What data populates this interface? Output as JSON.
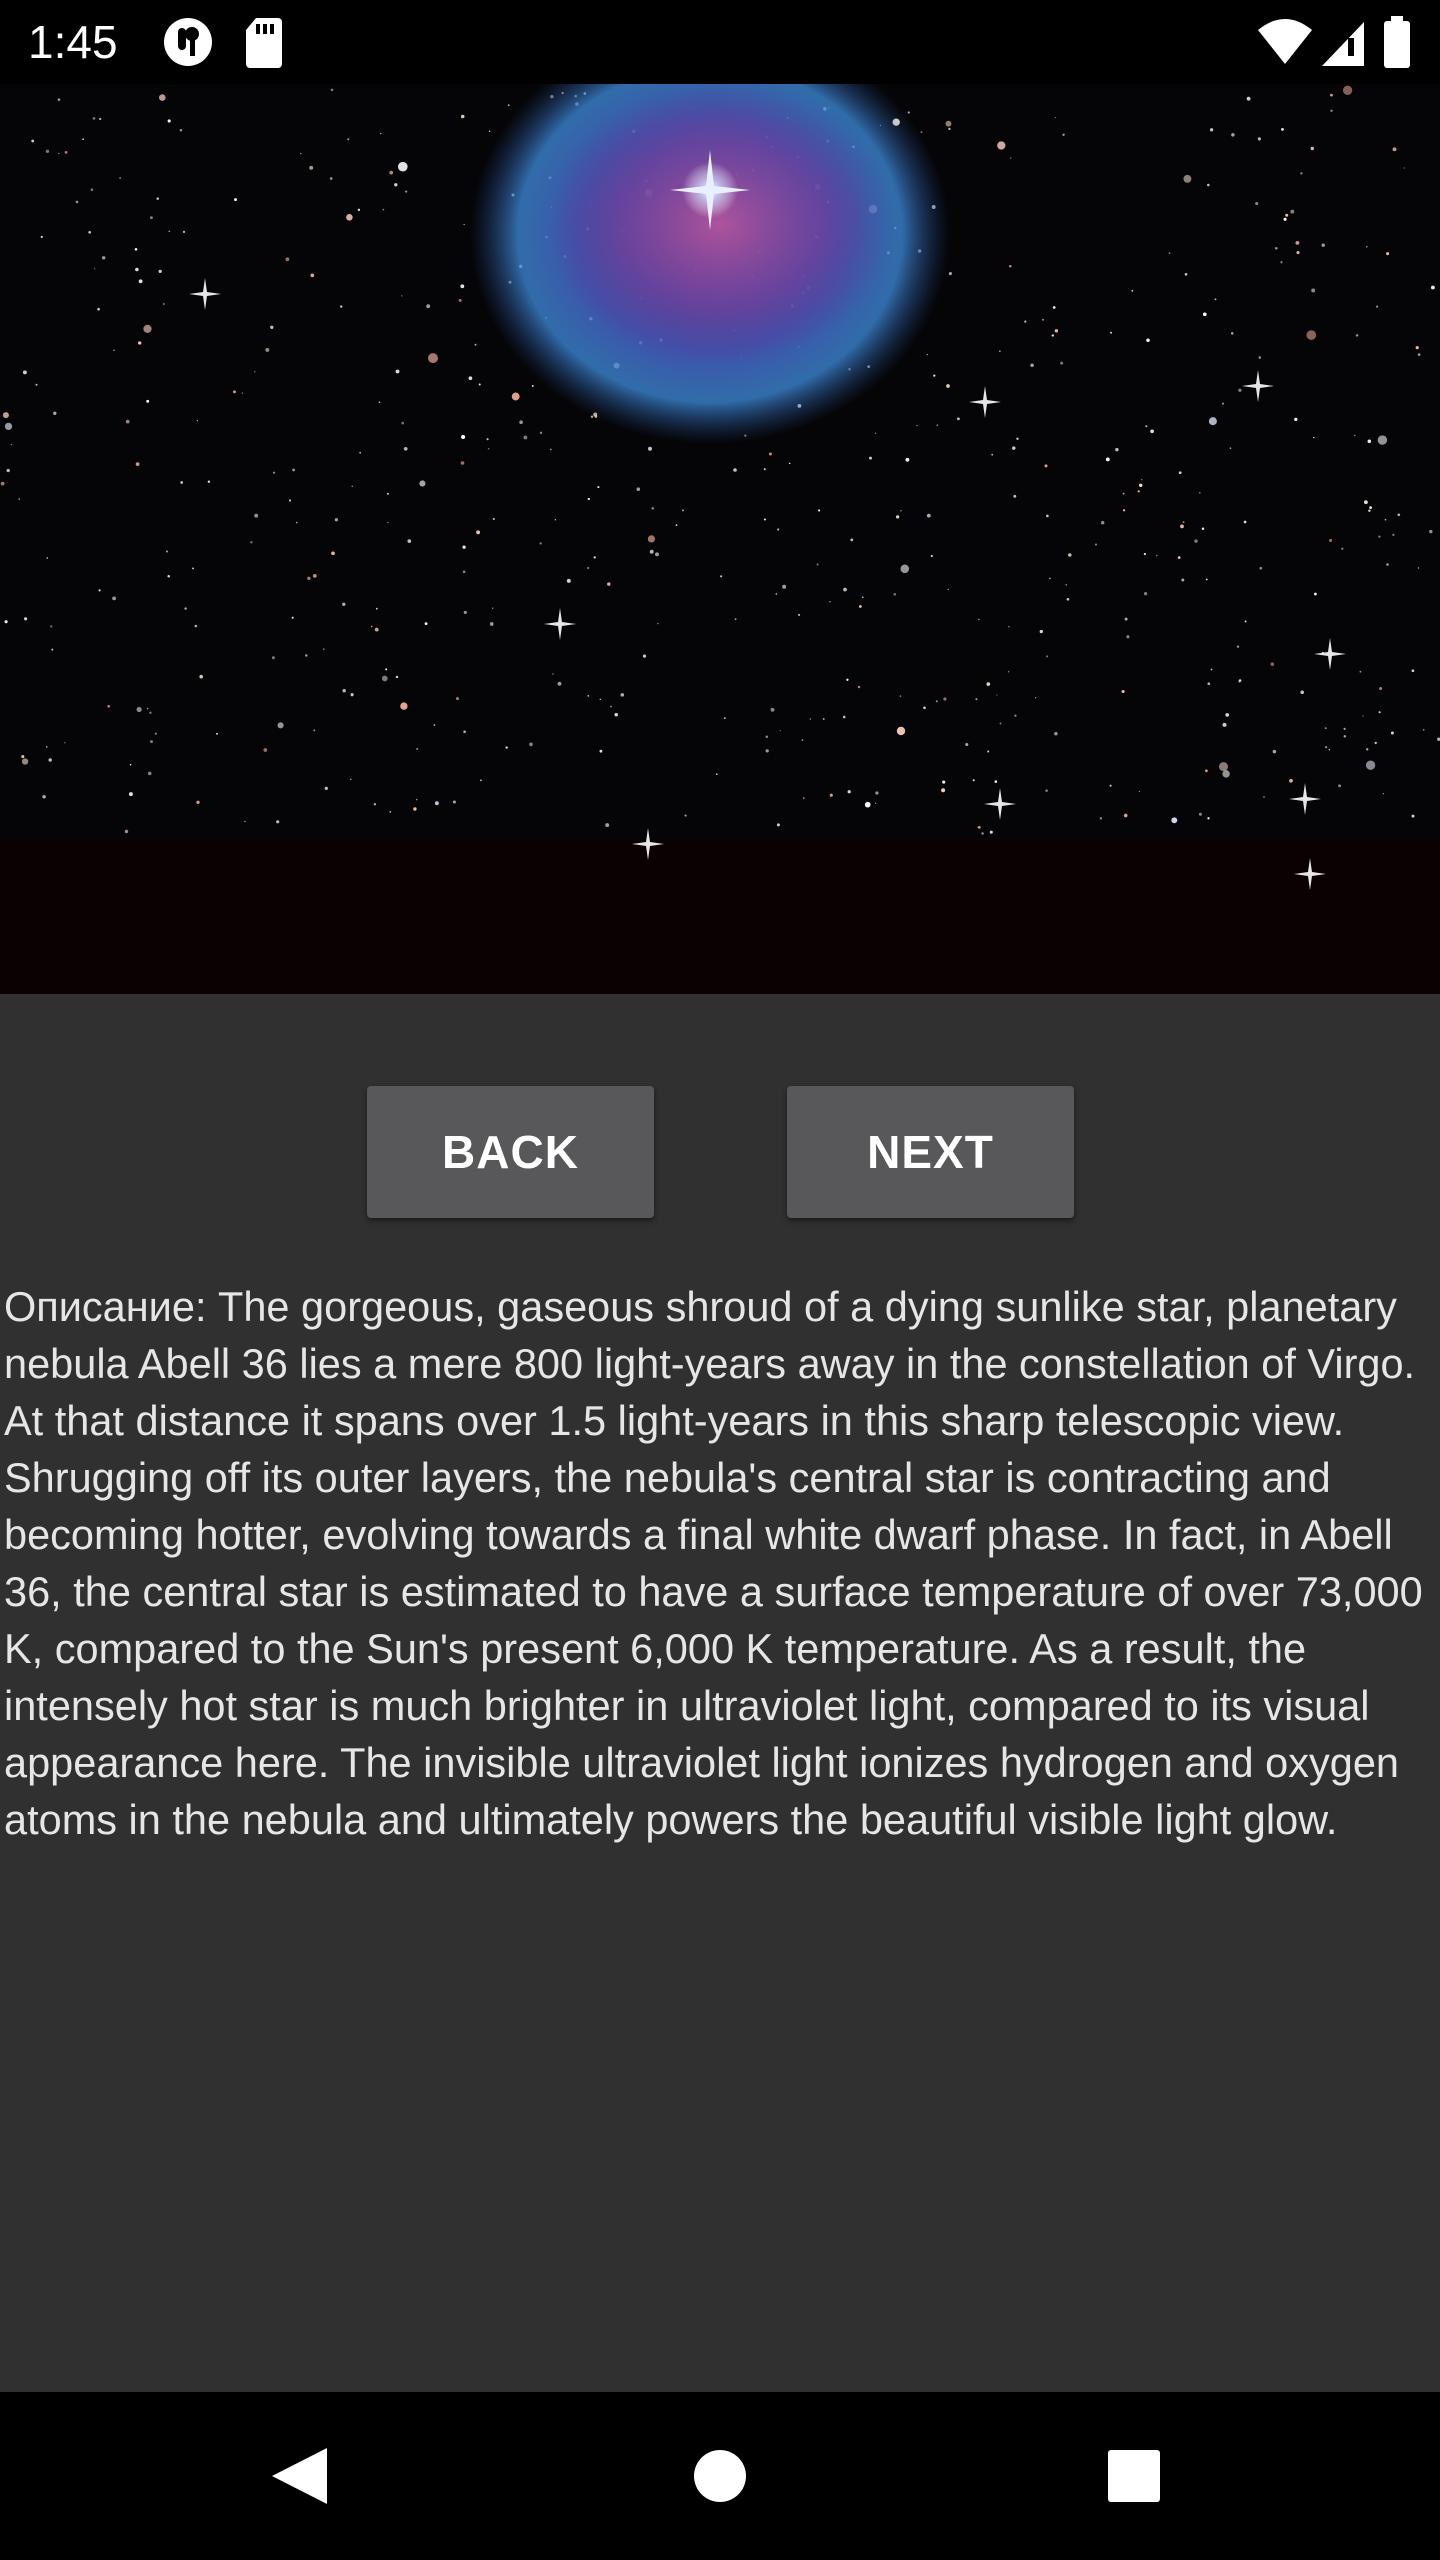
{
  "status_bar": {
    "time": "1:45",
    "icons": [
      "notification-icon",
      "sd-card-icon",
      "wifi-icon",
      "cell-signal-icon",
      "battery-icon"
    ]
  },
  "image": {
    "subject": "nebula-photo"
  },
  "buttons": {
    "back_label": "BACK",
    "next_label": "NEXT"
  },
  "description": {
    "text": "Описание: The gorgeous, gaseous shroud of a dying sunlike star, planetary nebula Abell 36 lies a mere 800 light-years away in the constellation of Virgo. At that distance it spans over 1.5 light-years in this sharp telescopic view. Shrugging off its outer layers, the nebula's central star is contracting and becoming hotter, evolving towards a final white dwarf phase. In fact, in Abell 36, the central star is estimated to have a surface temperature of over 73,000 K, compared to the Sun's present 6,000 K temperature. As a result, the intensely hot star is much brighter in ultraviolet light, compared to its visual appearance here. The invisible ultraviolet light ionizes hydrogen and oxygen atoms in the nebula and ultimately powers the beautiful visible light glow."
  },
  "nav_bar": {
    "buttons": [
      "back-icon",
      "home-icon",
      "recents-icon"
    ]
  },
  "colors": {
    "background": "#303030",
    "button": "#58585a",
    "text": "#e6e6e6",
    "bars": "#000000"
  }
}
